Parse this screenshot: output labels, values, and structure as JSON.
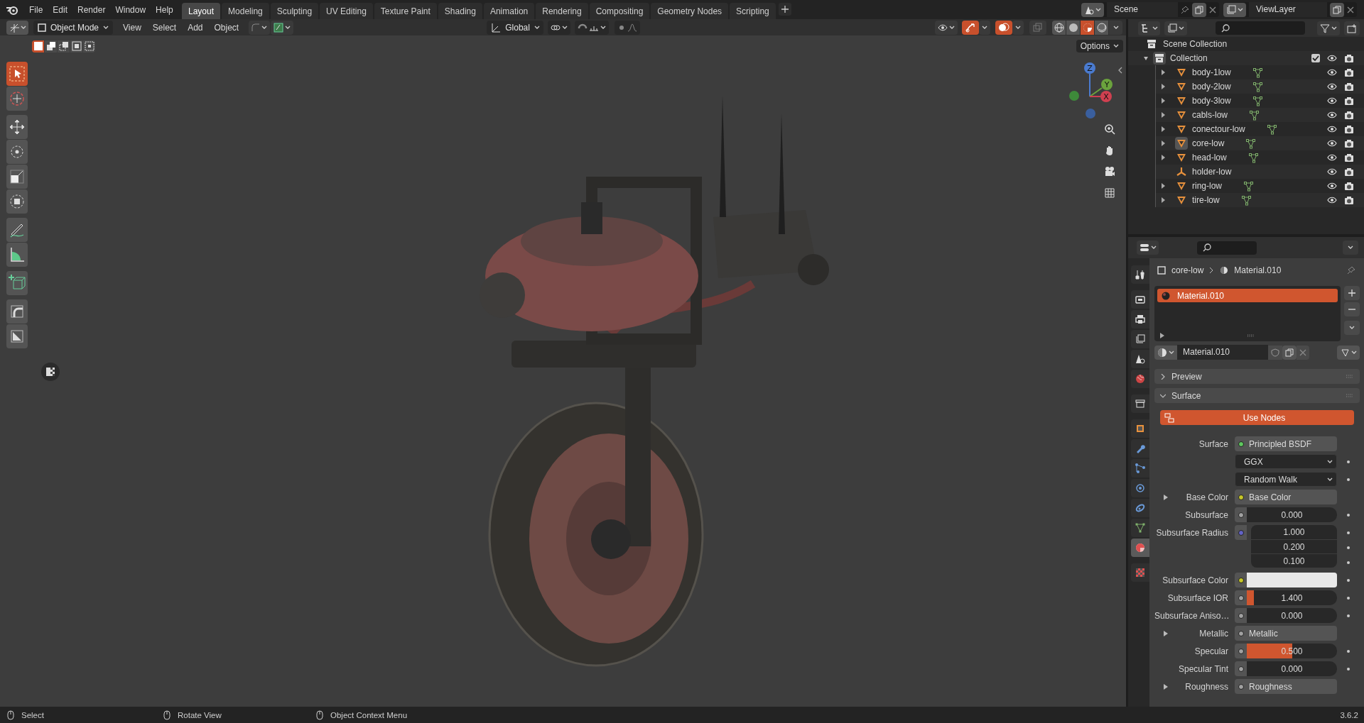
{
  "top_bar": {
    "menus": [
      "File",
      "Edit",
      "Render",
      "Window",
      "Help"
    ],
    "workspaces": [
      {
        "label": "Layout",
        "selected": true
      },
      {
        "label": "Modeling",
        "selected": false
      },
      {
        "label": "Sculpting",
        "selected": false
      },
      {
        "label": "UV Editing",
        "selected": false
      },
      {
        "label": "Texture Paint",
        "selected": false
      },
      {
        "label": "Shading",
        "selected": false
      },
      {
        "label": "Animation",
        "selected": false
      },
      {
        "label": "Rendering",
        "selected": false
      },
      {
        "label": "Compositing",
        "selected": false
      },
      {
        "label": "Geometry Nodes",
        "selected": false
      },
      {
        "label": "Scripting",
        "selected": false
      }
    ],
    "scene": "Scene",
    "view_layer": "ViewLayer"
  },
  "viewport": {
    "mode": "Object Mode",
    "menus": [
      "View",
      "Select",
      "Add",
      "Object"
    ],
    "orientation": "Global",
    "options": "Options",
    "selection_modes": [
      {
        "kind": "set",
        "selected": true
      },
      {
        "kind": "extend",
        "selected": false
      },
      {
        "kind": "subtract",
        "selected": false
      },
      {
        "kind": "invert",
        "selected": false
      },
      {
        "kind": "intersect",
        "selected": false
      }
    ],
    "toggles": [
      {
        "kind": "gizmo",
        "on": true
      },
      {
        "kind": "overlay",
        "on": true
      },
      {
        "kind": "xray",
        "on": false
      }
    ],
    "shading": [
      {
        "kind": "wireframe",
        "selected": false
      },
      {
        "kind": "solid",
        "selected": false
      },
      {
        "kind": "material",
        "selected": true
      },
      {
        "kind": "rendered",
        "selected": false
      }
    ],
    "gizmo_axes": [
      "Z",
      "Y",
      "X"
    ],
    "tools": [
      [
        {
          "kind": "select",
          "selected": true
        },
        {
          "kind": "cursor",
          "selected": false
        }
      ],
      [
        {
          "kind": "move",
          "selected": false
        },
        {
          "kind": "rotate",
          "selected": false
        },
        {
          "kind": "scale",
          "selected": false
        },
        {
          "kind": "transform",
          "selected": false
        }
      ],
      [
        {
          "kind": "annotate",
          "selected": false
        },
        {
          "kind": "measure",
          "selected": false
        }
      ],
      [
        {
          "kind": "add-cube",
          "selected": false
        }
      ],
      [
        {
          "kind": "corner",
          "selected": false
        },
        {
          "kind": "diagonal",
          "selected": false
        }
      ]
    ]
  },
  "outliner": {
    "root": "Scene Collection",
    "collection": {
      "label": "Collection",
      "expanded": true,
      "checked": true,
      "children": [
        {
          "label": "body-1low",
          "kind": "mesh",
          "expandable": true,
          "active": false
        },
        {
          "label": "body-2low",
          "kind": "mesh",
          "expandable": true,
          "active": false
        },
        {
          "label": "body-3low",
          "kind": "mesh",
          "expandable": true,
          "active": false
        },
        {
          "label": "cabls-low",
          "kind": "mesh",
          "expandable": true,
          "active": false
        },
        {
          "label": "conectour-low",
          "kind": "mesh",
          "expandable": true,
          "active": false
        },
        {
          "label": "core-low",
          "kind": "mesh",
          "expandable": true,
          "active": true
        },
        {
          "label": "head-low",
          "kind": "mesh",
          "expandable": true,
          "active": false
        },
        {
          "label": "holder-low",
          "kind": "empty",
          "expandable": false,
          "active": false
        },
        {
          "label": "ring-low",
          "kind": "mesh",
          "expandable": true,
          "active": false
        },
        {
          "label": "tire-low",
          "kind": "mesh",
          "expandable": true,
          "active": false
        }
      ]
    }
  },
  "properties": {
    "tabs": [
      [
        {
          "kind": "tool",
          "selected": false
        }
      ],
      [
        {
          "kind": "render",
          "selected": false
        },
        {
          "kind": "output",
          "selected": false
        },
        {
          "kind": "view_layer",
          "selected": false
        },
        {
          "kind": "scene",
          "selected": false
        },
        {
          "kind": "world",
          "selected": false
        }
      ],
      [
        {
          "kind": "collection",
          "selected": false
        }
      ],
      [
        {
          "kind": "object",
          "selected": false
        },
        {
          "kind": "modifier",
          "selected": false
        },
        {
          "kind": "particles",
          "selected": false
        },
        {
          "kind": "physics",
          "selected": false
        },
        {
          "kind": "constraints",
          "selected": false
        },
        {
          "kind": "data",
          "selected": false
        },
        {
          "kind": "material",
          "selected": true
        }
      ],
      [
        {
          "kind": "texture",
          "selected": false
        }
      ]
    ],
    "breadcrumb": [
      "core-low",
      "Material.010"
    ],
    "slots": [
      {
        "label": "Material.010",
        "selected": true
      }
    ],
    "material": "Material.010",
    "panels": [
      {
        "label": "Preview",
        "expanded": false
      },
      {
        "label": "Surface",
        "expanded": true
      }
    ],
    "use_nodes": {
      "label": "Use Nodes",
      "on": true
    },
    "inputs": [
      {
        "kind": "link",
        "label": "Surface",
        "value": "Principled BSDF",
        "color": "#5fc95f",
        "expandable": false,
        "animatable": false
      },
      {
        "kind": "dropdown",
        "value": "GGX",
        "expandable": false,
        "animatable": true
      },
      {
        "kind": "dropdown",
        "value": "Random Walk",
        "expandable": false,
        "animatable": true
      },
      {
        "kind": "link",
        "label": "Base Color",
        "value": "Base Color",
        "color": "#c7c729",
        "expandable": true,
        "animatable": false
      },
      {
        "kind": "slider",
        "label": "Subsurface",
        "value": "0.000",
        "level": 0,
        "color": "#a1a1a1",
        "expandable": false,
        "animatable": true
      },
      {
        "kind": "vector",
        "label": "Subsurface Radius",
        "values": [
          "1.000",
          "0.200",
          "0.100"
        ],
        "color": "#6363c7",
        "expandable": false,
        "animatable": true
      },
      {
        "kind": "swatch",
        "label": "Subsurface Color",
        "color": "#e9e9e9",
        "expandable": false,
        "animatable": true
      },
      {
        "kind": "slider",
        "label": "Subsurface IOR",
        "value": "1.400",
        "level": 0.08,
        "color": "#a1a1a1",
        "expandable": false,
        "animatable": true
      },
      {
        "kind": "slider",
        "label": "Subsurface Aniso…",
        "value": "0.000",
        "level": 0,
        "color": "#a1a1a1",
        "expandable": false,
        "animatable": true
      },
      {
        "kind": "link",
        "label": "Metallic",
        "value": "Metallic",
        "color": "#a1a1a1",
        "expandable": true,
        "animatable": false
      },
      {
        "kind": "slider",
        "label": "Specular",
        "value": "0.500",
        "level": 0.5,
        "color": "#a1a1a1",
        "expandable": false,
        "animatable": true
      },
      {
        "kind": "slider",
        "label": "Specular Tint",
        "value": "0.000",
        "level": 0,
        "color": "#a1a1a1",
        "expandable": false,
        "animatable": true
      },
      {
        "kind": "link",
        "label": "Roughness",
        "value": "Roughness",
        "color": "#a1a1a1",
        "expandable": true,
        "animatable": false
      }
    ]
  },
  "status_bar": {
    "hints": [
      "Select",
      "Rotate View",
      "Object Context Menu"
    ],
    "version": "3.6.2"
  }
}
